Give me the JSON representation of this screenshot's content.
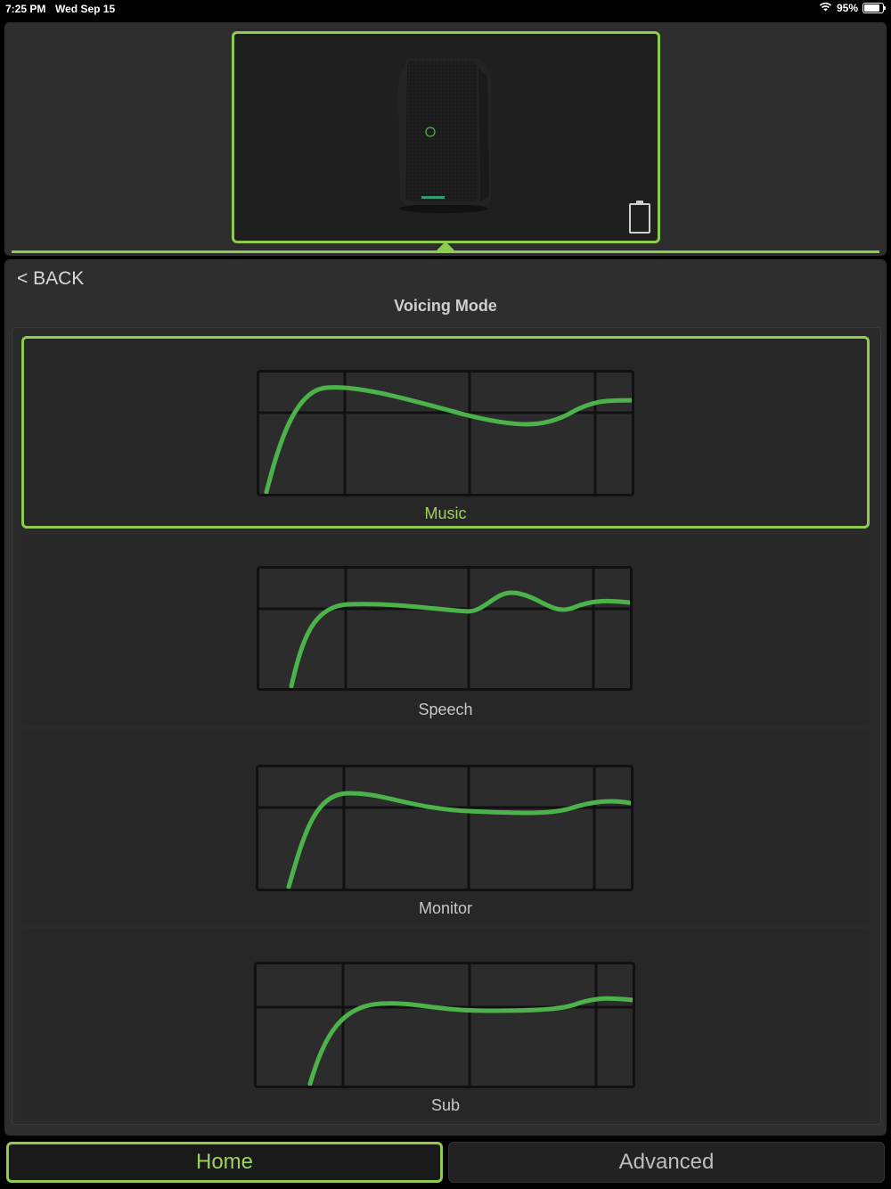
{
  "status_bar": {
    "time": "7:25 PM",
    "date": "Wed Sep 15",
    "battery_percent": "95%",
    "battery_level": 0.95
  },
  "header": {
    "device": {
      "image": "speaker-icon",
      "battery_icon": "battery-icon"
    }
  },
  "nav": {
    "back_label": "< BACK"
  },
  "page": {
    "title": "Voicing Mode"
  },
  "modes": [
    {
      "label": "Music",
      "selected": true
    },
    {
      "label": "Speech",
      "selected": false
    },
    {
      "label": "Monitor",
      "selected": false
    },
    {
      "label": "Sub",
      "selected": false
    }
  ],
  "tabs": [
    {
      "label": "Home",
      "active": true
    },
    {
      "label": "Advanced",
      "active": false
    }
  ],
  "colors": {
    "accent": "#8fcb4f",
    "curve": "#4cb34a",
    "background": "#2e2e2e"
  }
}
